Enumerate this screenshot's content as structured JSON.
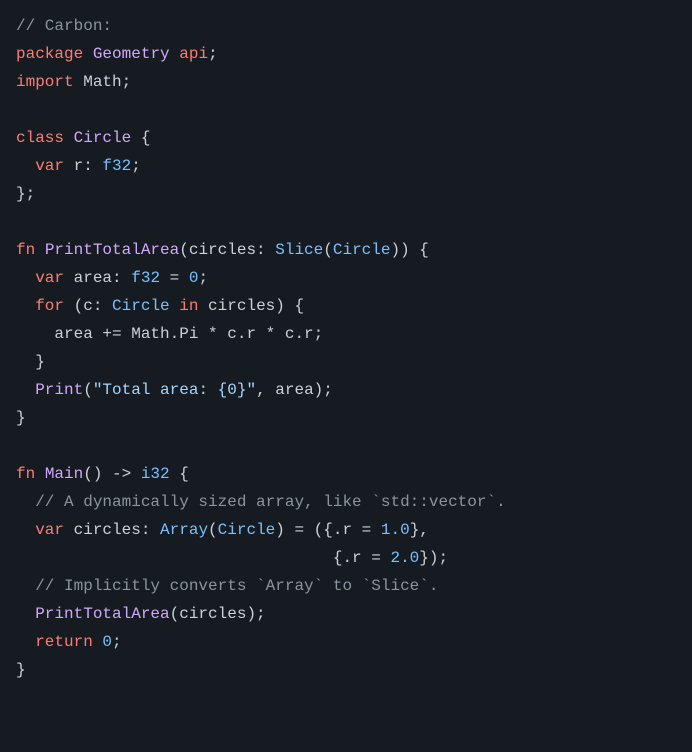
{
  "code": {
    "line1": "// Carbon:",
    "line2a": "package",
    "line2b": "Geometry",
    "line2c": "api",
    "line2d": ";",
    "line3a": "import",
    "line3b": " Math;",
    "line5a": "class",
    "line5b": "Circle",
    "line5c": " {",
    "line6a": "  ",
    "line6b": "var",
    "line6c": " r: ",
    "line6d": "f32",
    "line6e": ";",
    "line7": "};",
    "line9a": "fn",
    "line9b": "PrintTotalArea",
    "line9c": "(circles: ",
    "line9d": "Slice",
    "line9e": "(",
    "line9f": "Circle",
    "line9g": ")) {",
    "line10a": "  ",
    "line10b": "var",
    "line10c": " area: ",
    "line10d": "f32",
    "line10e": " = ",
    "line10f": "0",
    "line10g": ";",
    "line11a": "  ",
    "line11b": "for",
    "line11c": " (c: ",
    "line11d": "Circle",
    "line11e": " ",
    "line11f": "in",
    "line11g": " circles) {",
    "line12a": "    area += Math.Pi * c.r * c.r;",
    "line13": "  }",
    "line14a": "  ",
    "line14b": "Print",
    "line14c": "(",
    "line14d": "\"Total area: {0}\"",
    "line14e": ", area);",
    "line15": "}",
    "line17a": "fn",
    "line17b": "Main",
    "line17c": "() -> ",
    "line17d": "i32",
    "line17e": " {",
    "line18": "  // A dynamically sized array, like `std::vector`.",
    "line19a": "  ",
    "line19b": "var",
    "line19c": " circles: ",
    "line19d": "Array",
    "line19e": "(",
    "line19f": "Circle",
    "line19g": ") = ({.r = ",
    "line19h": "1.0",
    "line19i": "},",
    "line20a": "                                 {.r = ",
    "line20b": "2.0",
    "line20c": "});",
    "line21": "  // Implicitly converts `Array` to `Slice`.",
    "line22a": "  ",
    "line22b": "PrintTotalArea",
    "line22c": "(circles);",
    "line23a": "  ",
    "line23b": "return",
    "line23c": " ",
    "line23d": "0",
    "line23e": ";",
    "line24": "}"
  }
}
